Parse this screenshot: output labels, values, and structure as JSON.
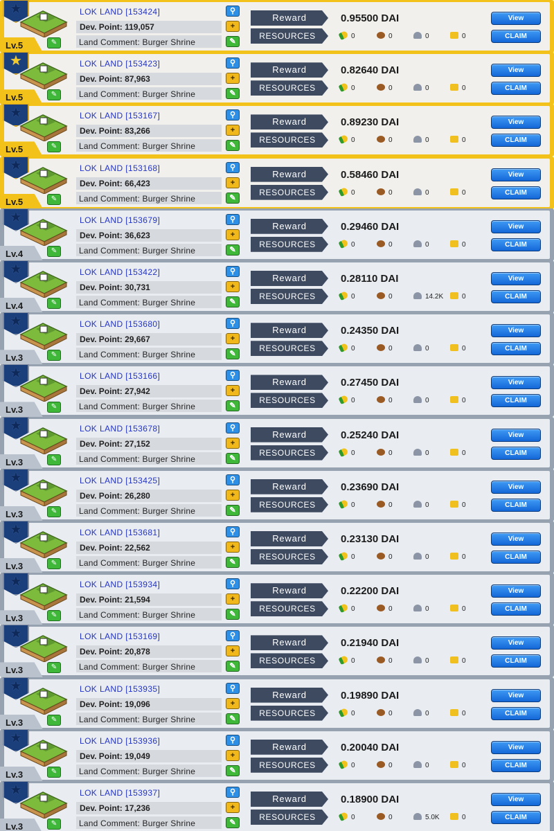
{
  "labels": {
    "reward": "Reward",
    "resources": "RESOURCES",
    "view": "View",
    "claim": "CLAIM",
    "dev_point_prefix": "Dev. Point: ",
    "land_comment_prefix": "Land Comment: "
  },
  "icons": {
    "badge": "shield-star-icon",
    "search": "magnifier-icon",
    "add": "plus-icon",
    "edit": "pencil-icon",
    "corn": "corn-icon",
    "wood": "wood-log-icon",
    "stone": "stone-icon",
    "gold": "gold-icon"
  },
  "colors": {
    "gold_frame": "#f2c21b",
    "silver_frame": "#97a2b1",
    "button_blue": "#1f7de6",
    "tag_dark": "#3d4a5f",
    "land_name_blue": "#2434c4"
  },
  "lands": [
    {
      "name": "LOK LAND [153424]",
      "dev_point": "Dev. Point: 119,057",
      "comment": "Land Comment: Burger Shrine",
      "level": "Lv.5",
      "tier": "gold",
      "badge_star": "dark",
      "reward": "0.95500 DAI",
      "resources": [
        "0",
        "0",
        "0",
        "0"
      ]
    },
    {
      "name": "LOK LAND [153423]",
      "dev_point": "Dev. Point: 87,963",
      "comment": "Land Comment: Burger Shrine",
      "level": "Lv.5",
      "tier": "gold",
      "badge_star": "gold",
      "reward": "0.82640 DAI",
      "resources": [
        "0",
        "0",
        "0",
        "0"
      ]
    },
    {
      "name": "LOK LAND [153167]",
      "dev_point": "Dev. Point: 83,266",
      "comment": "Land Comment: Burger Shrine",
      "level": "Lv.5",
      "tier": "gold",
      "badge_star": "dark",
      "reward": "0.89230 DAI",
      "resources": [
        "0",
        "0",
        "0",
        "0"
      ]
    },
    {
      "name": "LOK LAND [153168]",
      "dev_point": "Dev. Point: 66,423",
      "comment": "Land Comment: Burger Shrine",
      "level": "Lv.5",
      "tier": "gold",
      "badge_star": "dark",
      "reward": "0.58460 DAI",
      "resources": [
        "0",
        "0",
        "0",
        "0"
      ]
    },
    {
      "name": "LOK LAND [153679]",
      "dev_point": "Dev. Point: 36,623",
      "comment": "Land Comment: Burger Shrine",
      "level": "Lv.4",
      "tier": "silver",
      "badge_star": "dark",
      "reward": "0.29460 DAI",
      "resources": [
        "0",
        "0",
        "0",
        "0"
      ]
    },
    {
      "name": "LOK LAND [153422]",
      "dev_point": "Dev. Point: 30,731",
      "comment": "Land Comment: Burger Shrine",
      "level": "Lv.4",
      "tier": "silver",
      "badge_star": "dark",
      "reward": "0.28110 DAI",
      "resources": [
        "0",
        "0",
        "14.2K",
        "0"
      ]
    },
    {
      "name": "LOK LAND [153680]",
      "dev_point": "Dev. Point: 29,667",
      "comment": "Land Comment: Burger Shrine",
      "level": "Lv.3",
      "tier": "silver",
      "badge_star": "dark",
      "reward": "0.24350 DAI",
      "resources": [
        "0",
        "0",
        "0",
        "0"
      ]
    },
    {
      "name": "LOK LAND [153166]",
      "dev_point": "Dev. Point: 27,942",
      "comment": "Land Comment: Burger Shrine",
      "level": "Lv.3",
      "tier": "silver",
      "badge_star": "dark",
      "reward": "0.27450 DAI",
      "resources": [
        "0",
        "0",
        "0",
        "0"
      ]
    },
    {
      "name": "LOK LAND [153678]",
      "dev_point": "Dev. Point: 27,152",
      "comment": "Land Comment: Burger Shrine",
      "level": "Lv.3",
      "tier": "silver",
      "badge_star": "dark",
      "reward": "0.25240 DAI",
      "resources": [
        "0",
        "0",
        "0",
        "0"
      ]
    },
    {
      "name": "LOK LAND [153425]",
      "dev_point": "Dev. Point: 26,280",
      "comment": "Land Comment: Burger Shrine",
      "level": "Lv.3",
      "tier": "silver",
      "badge_star": "dark",
      "reward": "0.23690 DAI",
      "resources": [
        "0",
        "0",
        "0",
        "0"
      ]
    },
    {
      "name": "LOK LAND [153681]",
      "dev_point": "Dev. Point: 22,562",
      "comment": "Land Comment: Burger Shrine",
      "level": "Lv.3",
      "tier": "silver",
      "badge_star": "dark",
      "reward": "0.23130 DAI",
      "resources": [
        "0",
        "0",
        "0",
        "0"
      ]
    },
    {
      "name": "LOK LAND [153934]",
      "dev_point": "Dev. Point: 21,594",
      "comment": "Land Comment: Burger Shrine",
      "level": "Lv.3",
      "tier": "silver",
      "badge_star": "dark",
      "reward": "0.22200 DAI",
      "resources": [
        "0",
        "0",
        "0",
        "0"
      ]
    },
    {
      "name": "LOK LAND [153169]",
      "dev_point": "Dev. Point: 20,878",
      "comment": "Land Comment: Burger Shrine",
      "level": "Lv.3",
      "tier": "silver",
      "badge_star": "dark",
      "reward": "0.21940 DAI",
      "resources": [
        "0",
        "0",
        "0",
        "0"
      ]
    },
    {
      "name": "LOK LAND [153935]",
      "dev_point": "Dev. Point: 19,096",
      "comment": "Land Comment: Burger Shrine",
      "level": "Lv.3",
      "tier": "silver",
      "badge_star": "dark",
      "reward": "0.19890 DAI",
      "resources": [
        "0",
        "0",
        "0",
        "0"
      ]
    },
    {
      "name": "LOK LAND [153936]",
      "dev_point": "Dev. Point: 19,049",
      "comment": "Land Comment: Burger Shrine",
      "level": "Lv.3",
      "tier": "silver",
      "badge_star": "dark",
      "reward": "0.20040 DAI",
      "resources": [
        "0",
        "0",
        "0",
        "0"
      ]
    },
    {
      "name": "LOK LAND [153937]",
      "dev_point": "Dev. Point: 17,236",
      "comment": "Land Comment: Burger Shrine",
      "level": "Lv.3",
      "tier": "silver",
      "badge_star": "dark",
      "reward": "0.18900 DAI",
      "resources": [
        "0",
        "0",
        "5.0K",
        "0"
      ]
    }
  ]
}
